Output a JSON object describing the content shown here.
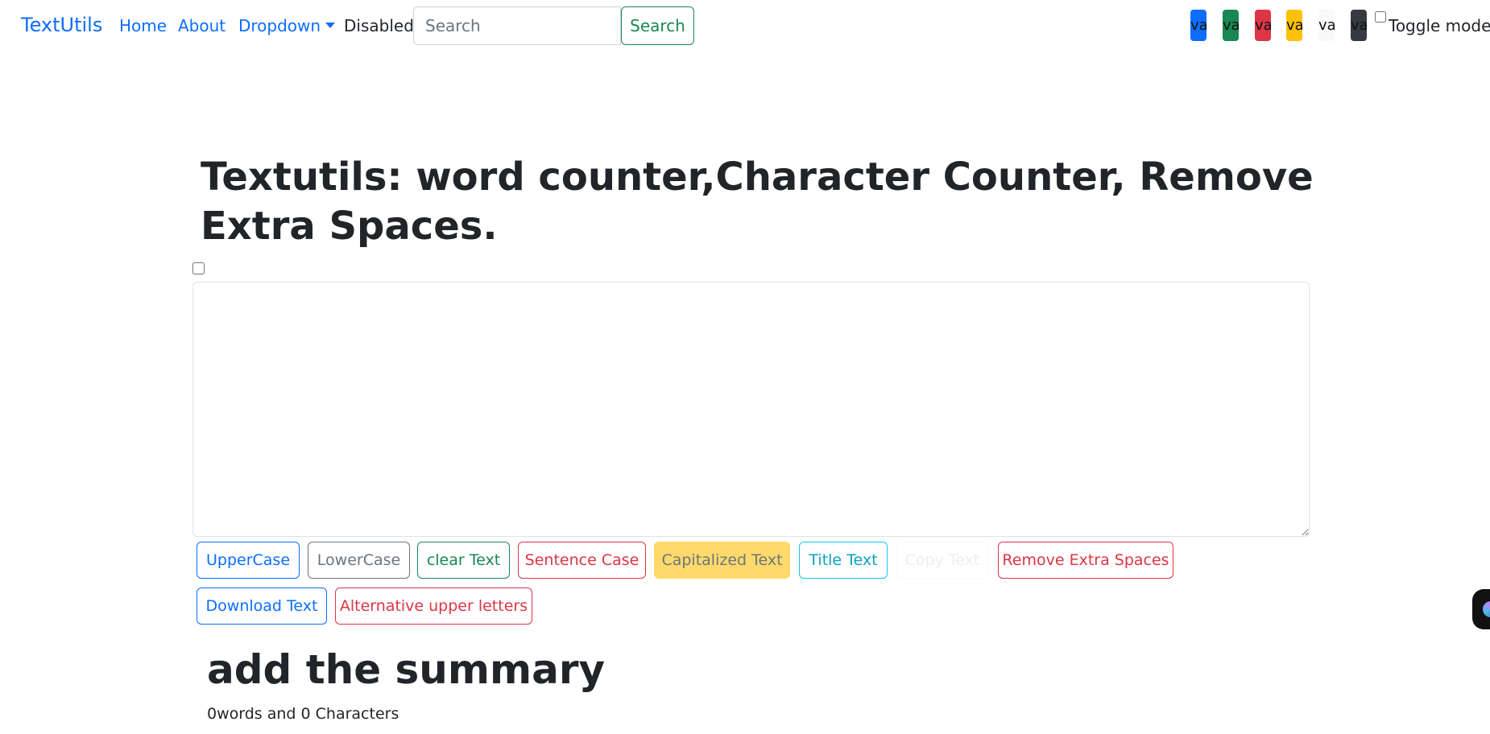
{
  "navbar": {
    "brand": "TextUtils",
    "links": {
      "home": "Home",
      "about": "About",
      "dropdown": "Dropdown",
      "disabled": "Disabled"
    },
    "search": {
      "placeholder": "Search",
      "value": "",
      "button": "Search"
    },
    "swatches": [
      {
        "label": "va",
        "color": "#0d6efd"
      },
      {
        "label": "va",
        "color": "#198754"
      },
      {
        "label": "va",
        "color": "#dc3545"
      },
      {
        "label": "va",
        "color": "#ffc107"
      },
      {
        "label": "va",
        "color": "#f8f9fa"
      },
      {
        "label": "va",
        "color": "#343a40"
      }
    ],
    "toggle_label": "Toggle mode",
    "toggle_checked": false
  },
  "main": {
    "title": "Textutils: word counter,Character Counter, Remove Extra Spaces.",
    "textarea_value": "",
    "buttons": {
      "uppercase": "UpperCase",
      "lowercase": "LowerCase",
      "clear": "clear Text",
      "sentence": "Sentence Case",
      "capitalized": "Capitalized Text",
      "title": "Title Text",
      "copy": "Copy Text",
      "remove_spaces": "Remove Extra Spaces",
      "download": "Download Text",
      "alternative": "Alternative upper letters"
    }
  },
  "summary": {
    "heading": "add the summary",
    "text": "0words and 0 Characters"
  }
}
